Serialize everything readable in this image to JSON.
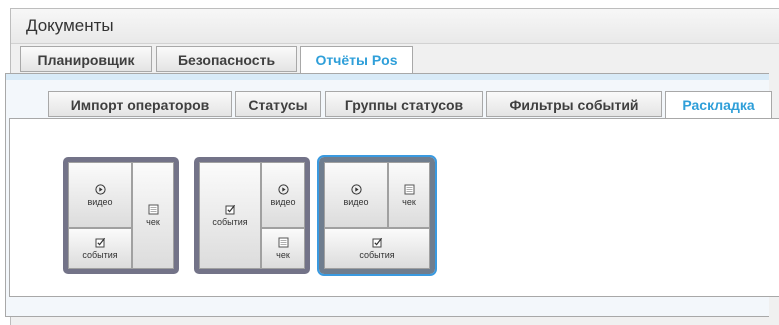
{
  "window": {
    "title": "Документы"
  },
  "main_tabs": [
    {
      "label": "Планировщик",
      "active": false
    },
    {
      "label": "Безопасность",
      "active": false
    },
    {
      "label": "Отчёты Pos",
      "active": true
    }
  ],
  "sub_tabs": [
    {
      "label": "Импорт операторов",
      "active": false
    },
    {
      "label": "Статусы",
      "active": false
    },
    {
      "label": "Группы статусов",
      "active": false
    },
    {
      "label": "Фильтры событий",
      "active": false
    },
    {
      "label": "Раскладка",
      "active": true
    }
  ],
  "layouts": [
    {
      "selected": false,
      "cells": [
        {
          "label": "видео",
          "icon": "play-icon"
        },
        {
          "label": "чек",
          "icon": "receipt-icon"
        },
        {
          "label": "события",
          "icon": "checkbox-icon"
        }
      ]
    },
    {
      "selected": false,
      "cells": [
        {
          "label": "события",
          "icon": "checkbox-icon"
        },
        {
          "label": "видео",
          "icon": "play-icon"
        },
        {
          "label": "чек",
          "icon": "receipt-icon"
        }
      ]
    },
    {
      "selected": true,
      "cells": [
        {
          "label": "видео",
          "icon": "play-icon"
        },
        {
          "label": "чек",
          "icon": "receipt-icon"
        },
        {
          "label": "события",
          "icon": "checkbox-icon"
        }
      ]
    }
  ],
  "colors": {
    "active_tab_text": "#2f9fd9",
    "selection_outline": "#3a9ae0",
    "layout_frame": "#737388"
  }
}
